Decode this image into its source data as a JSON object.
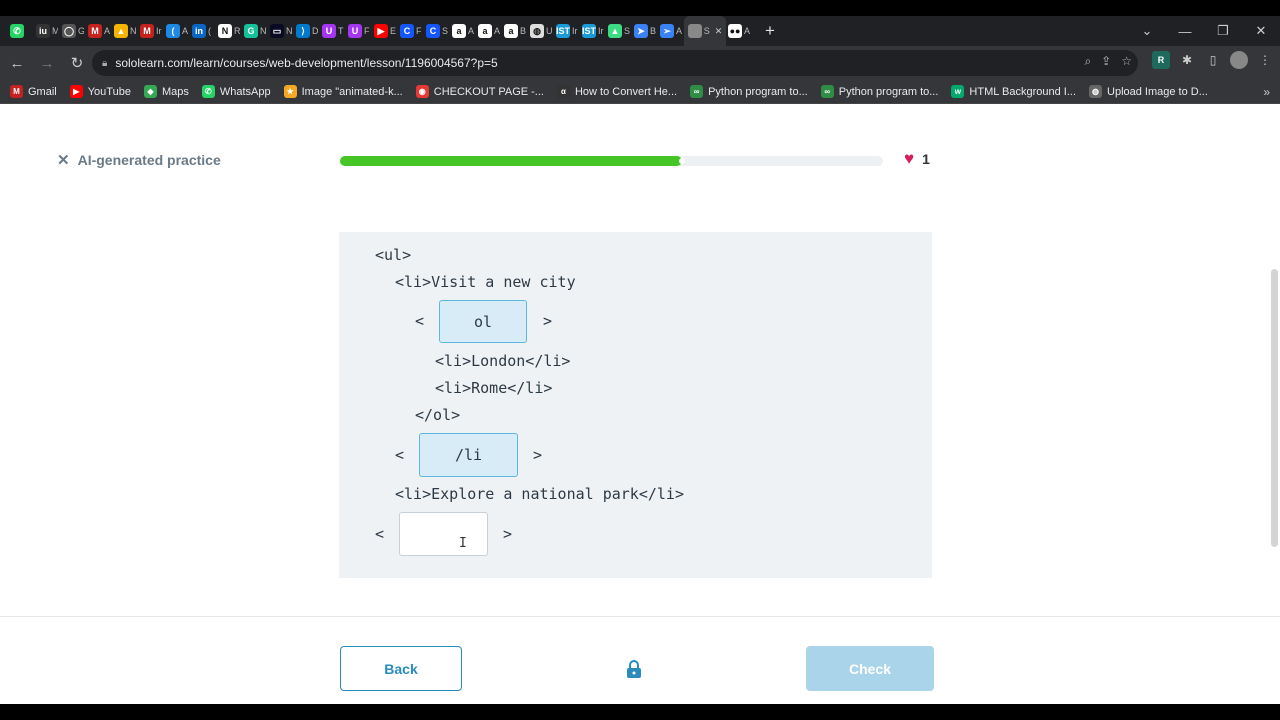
{
  "tabs": [
    {
      "icon": "whatsapp-icon",
      "color": "#25d366",
      "glyph": "✆",
      "label": ""
    },
    {
      "icon": "ilu-icon",
      "color": "#333",
      "glyph": "iu",
      "label": "M"
    },
    {
      "icon": "github-icon",
      "color": "#555",
      "glyph": "◯",
      "label": "G"
    },
    {
      "icon": "gmail-icon",
      "color": "#c5221f",
      "glyph": "M",
      "label": "A"
    },
    {
      "icon": "drive-icon",
      "color": "#f4b400",
      "glyph": "▲",
      "label": "N"
    },
    {
      "icon": "gmail-icon",
      "color": "#c5221f",
      "glyph": "M",
      "label": "Ir"
    },
    {
      "icon": "cursor-icon",
      "color": "#1e88e5",
      "glyph": "(",
      "label": "A"
    },
    {
      "icon": "linkedin-icon",
      "color": "#0a66c2",
      "glyph": "in",
      "label": "("
    },
    {
      "icon": "notion-icon",
      "color": "#fff",
      "glyph": "N",
      "label": "R"
    },
    {
      "icon": "grammarly-icon",
      "color": "#15c39a",
      "glyph": "G",
      "label": "N"
    },
    {
      "icon": "freecodecamp-icon",
      "color": "#0a0a23",
      "glyph": "▭",
      "label": "N"
    },
    {
      "icon": "vscode-icon",
      "color": "#007acc",
      "glyph": "⟩",
      "label": "D"
    },
    {
      "icon": "udemy-icon",
      "color": "#a435f0",
      "glyph": "U",
      "label": "T"
    },
    {
      "icon": "udemy-icon",
      "color": "#a435f0",
      "glyph": "U",
      "label": "F"
    },
    {
      "icon": "youtube-icon",
      "color": "#ff0000",
      "glyph": "▶",
      "label": "E"
    },
    {
      "icon": "codecademy-icon",
      "color": "#1557ff",
      "glyph": "C",
      "label": "F"
    },
    {
      "icon": "codecademy-icon",
      "color": "#1557ff",
      "glyph": "C",
      "label": "S"
    },
    {
      "icon": "amazon-icon",
      "color": "#fff",
      "glyph": "a",
      "label": "A"
    },
    {
      "icon": "amazon-icon",
      "color": "#fff",
      "glyph": "a",
      "label": "A"
    },
    {
      "icon": "amazon-icon",
      "color": "#fff",
      "glyph": "a",
      "label": "B"
    },
    {
      "icon": "globe-icon",
      "color": "#ddd",
      "glyph": "◍",
      "label": "U"
    },
    {
      "icon": "ist-icon",
      "color": "#1a9ad6",
      "glyph": "IST",
      "label": "Ir"
    },
    {
      "icon": "ist-icon",
      "color": "#1a9ad6",
      "glyph": "IST",
      "label": "Ir"
    },
    {
      "icon": "android-icon",
      "color": "#3ddc84",
      "glyph": "▲",
      "label": "S"
    },
    {
      "icon": "arrow-icon",
      "color": "#3b82f6",
      "glyph": "➤",
      "label": "B"
    },
    {
      "icon": "plane-icon",
      "color": "#3b82f6",
      "glyph": "➢",
      "label": "A"
    },
    {
      "icon": "sololearn-icon",
      "color": "#888",
      "glyph": "",
      "label": "S"
    },
    {
      "icon": "medium-icon",
      "color": "#fff",
      "glyph": "●●",
      "label": "A"
    }
  ],
  "address": {
    "url": "sololearn.com/learn/courses/web-development/lesson/1196004567?p=5"
  },
  "bookmarks": [
    {
      "label": "Gmail",
      "icon": "gmail-icon",
      "color": "#c5221f",
      "glyph": "M"
    },
    {
      "label": "YouTube",
      "icon": "youtube-icon",
      "color": "#ff0000",
      "glyph": "▶"
    },
    {
      "label": "Maps",
      "icon": "maps-icon",
      "color": "#34a853",
      "glyph": "◆"
    },
    {
      "label": "WhatsApp",
      "icon": "whatsapp-icon",
      "color": "#25d366",
      "glyph": "✆"
    },
    {
      "label": "Image \"animated-k...",
      "icon": "star-icon",
      "color": "#f5a623",
      "glyph": "★"
    },
    {
      "label": "CHECKOUT PAGE -...",
      "icon": "lips-icon",
      "color": "#e53935",
      "glyph": "◉"
    },
    {
      "label": "How to Convert He...",
      "icon": "alpha-icon",
      "color": "#333",
      "glyph": "α"
    },
    {
      "label": "Python program to...",
      "icon": "geeks-icon",
      "color": "#2f8d46",
      "glyph": "∞"
    },
    {
      "label": "Python program to...",
      "icon": "geeks-icon",
      "color": "#2f8d46",
      "glyph": "∞"
    },
    {
      "label": "HTML Background I...",
      "icon": "w-icon",
      "color": "#04aa6d",
      "glyph": "w"
    },
    {
      "label": "Upload Image to D...",
      "icon": "globe-icon",
      "color": "#666",
      "glyph": "◍"
    }
  ],
  "lesson": {
    "close_label": "AI-generated practice",
    "progress": 0.63,
    "lives": "1",
    "code_lines": [
      "<ul>",
      "<li>Visit a new city",
      "<li>London</li>",
      "<li>Rome</li>",
      "</ol>",
      "<li>Explore a national park</li>"
    ],
    "slot_open": "<",
    "slot_close": ">",
    "slots": [
      "ol",
      "/li",
      ""
    ],
    "back_label": "Back",
    "check_label": "Check"
  }
}
